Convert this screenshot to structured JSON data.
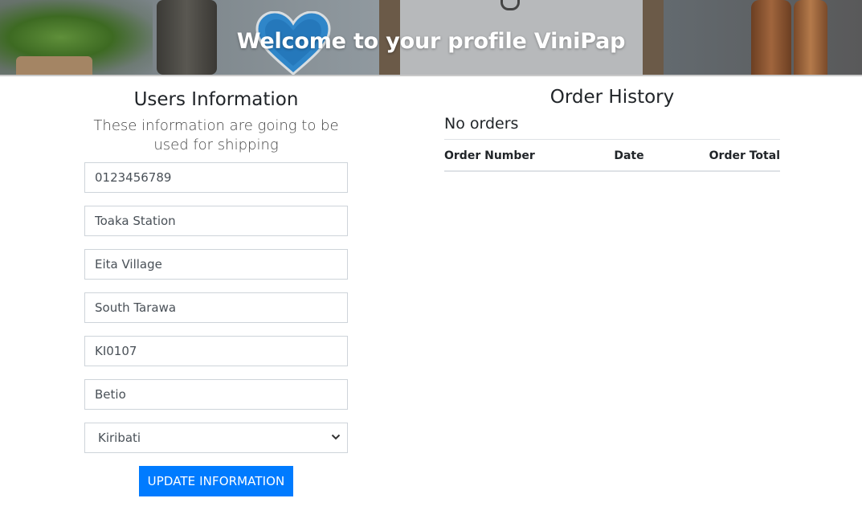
{
  "hero": {
    "title": "Welcome to your profile ViniPap"
  },
  "users_info": {
    "title": "Users Information",
    "subtitle": "These information are going to be used for shipping",
    "fields": {
      "phone": "0123456789",
      "address": "Toaka Station",
      "address2": "Eita Village",
      "city": "South Tarawa",
      "postcode": "KI0107",
      "county": "Betio"
    },
    "country": {
      "selected": "Kiribati"
    },
    "update_button": "UPDATE INFORMATION"
  },
  "order_history": {
    "title": "Order History",
    "empty_text": "No orders",
    "columns": [
      "Order Number",
      "Date",
      "Order Total"
    ]
  },
  "colors": {
    "primary": "#007bff",
    "heart": "#2f86c9"
  },
  "icons": {
    "heart": "heart-icon",
    "select_arrow": "chevron-down-icon"
  }
}
